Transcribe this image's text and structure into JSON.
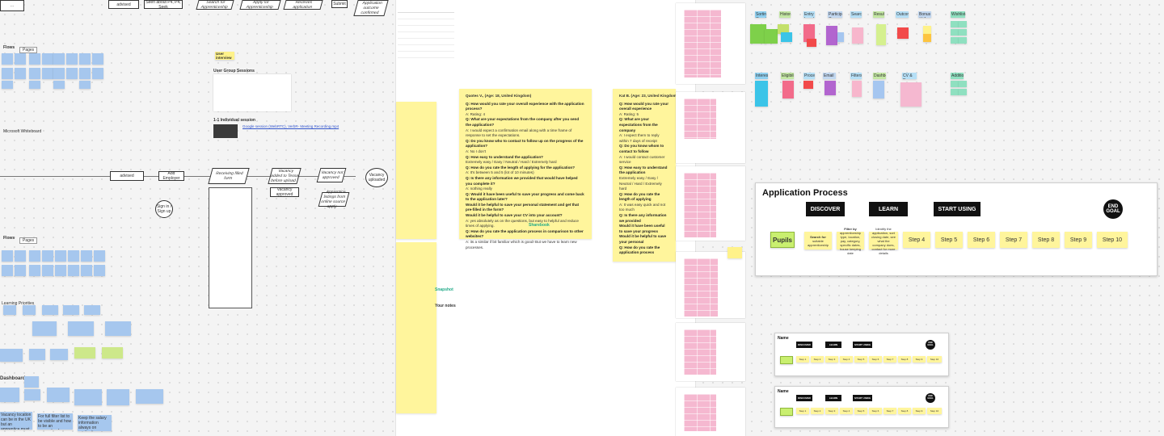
{
  "board": {
    "top_flow": [
      "advised",
      "Seen about P4, P4, Seek",
      "Search for Apprenticeship",
      "Apply for Apprenticeship",
      "Receives application",
      "Submit",
      "Application outcome confirmed"
    ],
    "left_sections": {
      "flows": "Flows",
      "flow_tag": "Pages",
      "flows2": "Flows",
      "flow_tag2": "Pages",
      "ms_whiteboard": "Microsoft Whiteboard",
      "dashboard": "Dashboard",
      "learning_priorities": "Learning Priorities"
    },
    "mid_flow": [
      "advised",
      "Add Employer",
      "Receiving filled form",
      "Vacancy added to Tessa before upload",
      "Vacancy approved",
      "Vacancy uploaded",
      "Vacancy not approved",
      "Sign in / Sign up",
      "Apprentice listings from online source apply"
    ],
    "research": {
      "sticker": "User interview",
      "user_group": "User Group Sessions",
      "one_to_one": "1-1 Individual session",
      "recording_link": "Google session (WebRTC), VerbR- Meeting Recording.mp4"
    },
    "dashboard_notes": [
      "Vacancy location can be in the UK but an apprentice must be from Scotland",
      "For full filter list to be visible and how to be an apprentice for service it works in Scotland",
      "Keep the salary information always on application up front"
    ]
  },
  "quotes": {
    "card1": {
      "title": "Quotes V., (Age: 18, United Kingdom)",
      "qa": [
        {
          "q": "Q: How would you rate your overall experience with the application process?",
          "a": "A: Rating: 4"
        },
        {
          "q": "Q: What are your expectations from the company after you send the application?",
          "a": "A: I would expect a confirmation email along with a time frame of response to set the expectations."
        },
        {
          "q": "Q: Do you know who to contact to follow up on the progress of the application?",
          "a": "A: No I don't"
        },
        {
          "q": "Q: How easy to understand the application?",
          "a": "Extremely easy / Easy / Neutral / Hard / Extremely hard"
        },
        {
          "q": "Q: How do you rate the length of applying for the application?",
          "a": "A: It's between 5 and 5 (lot of 10 minutes)"
        },
        {
          "q": "Q: Is there any information we provided that would have helped you complete it?",
          "a": "A: nothing really"
        },
        {
          "q": "Q: Would it have been useful to save your progress and come back to the application later?",
          "a": ""
        },
        {
          "q": "Would it be helpful to save your personal statement and get that pre-filled in the form?",
          "a": ""
        },
        {
          "q": "Would it be helpful to save your CV into your account?",
          "a": "A: yes absolutely as on the questions, but easy to helpful and reduce times of applying."
        },
        {
          "q": "Q: How do you rate the application process in comparison to other websites?",
          "a": "A: its a similar if bit familiar which is good! But we have to learn new processes."
        }
      ]
    },
    "card2": {
      "title": "Kat B. (Age: 23, United Kingdom)",
      "qa": [
        {
          "q": "Q: How would you rate your overall experience",
          "a": "A: Rating: 5"
        },
        {
          "q": "Q: What are your expectations from the company",
          "a": "A: I expect them to reply within 7 days of receipt"
        },
        {
          "q": "Q: Do you know whom to contact to follow",
          "a": "A: I would contact customer service"
        },
        {
          "q": "Q: How easy to understand the application",
          "a": "Extremely easy / Easy / Neutral / Hard / Extremely hard"
        },
        {
          "q": "Q: How do you rate the length of applying",
          "a": "A: It was easy quick and not too much"
        },
        {
          "q": "Q: Is there any information we provided",
          "a": ""
        },
        {
          "q": "Would it have been useful to save your progress",
          "a": ""
        },
        {
          "q": "Would it be helpful to save your personal",
          "a": ""
        },
        {
          "q": "Q: How do you rate the application process",
          "a": ""
        }
      ]
    }
  },
  "notes": {
    "snapshot": "Snapshot",
    "your_notes": "Your notes",
    "sharebook": "Sharebook"
  },
  "palette": {
    "headers": [
      "Sorting Questions",
      "History",
      "Entry Level",
      "Participant Comments",
      "Search",
      "Results",
      "Outcome",
      "Bonus / Life",
      "Wishlist"
    ],
    "headers2": [
      "Interesting",
      "Eligibility",
      "Process",
      "Email",
      "Filters",
      "Dashboard",
      "CV & Docs",
      "Additionally"
    ]
  },
  "application_process": {
    "title": "Application Process",
    "phases": [
      "DISCOVER",
      "LEARN",
      "START USING"
    ],
    "end_goal": "END GOAL",
    "persona": "Pupils",
    "note1_bold": "Search for",
    "note1": "suitable apprenticeship",
    "note2_bold": "Filter by",
    "note2": "apprenticeship type, location, pay, category, specific dates, house keeping date",
    "note3": "Identify the application, sort closing date, see what the company does, contact for more details",
    "steps": [
      "Step 4",
      "Step 5",
      "Step 6",
      "Step 7",
      "Step 8",
      "Step 9",
      "Step 10"
    ]
  },
  "mini_frames": {
    "title": "Name",
    "phases": [
      "DISCOVER",
      "LEARN",
      "START USING"
    ],
    "end_goal": "END GOAL",
    "steps": [
      "Step 1",
      "Step 2",
      "Step 3",
      "Step 4",
      "Step 5",
      "Step 6",
      "Step 7",
      "Step 8",
      "Step 9",
      "Step 10"
    ]
  },
  "colors": {
    "sticky_blue": "#a6c7ee",
    "sticky_yellow": "#fff28a",
    "sticky_pink": "#f5b8d0",
    "sticky_green": "#cde88a",
    "phase_black": "#111111"
  }
}
